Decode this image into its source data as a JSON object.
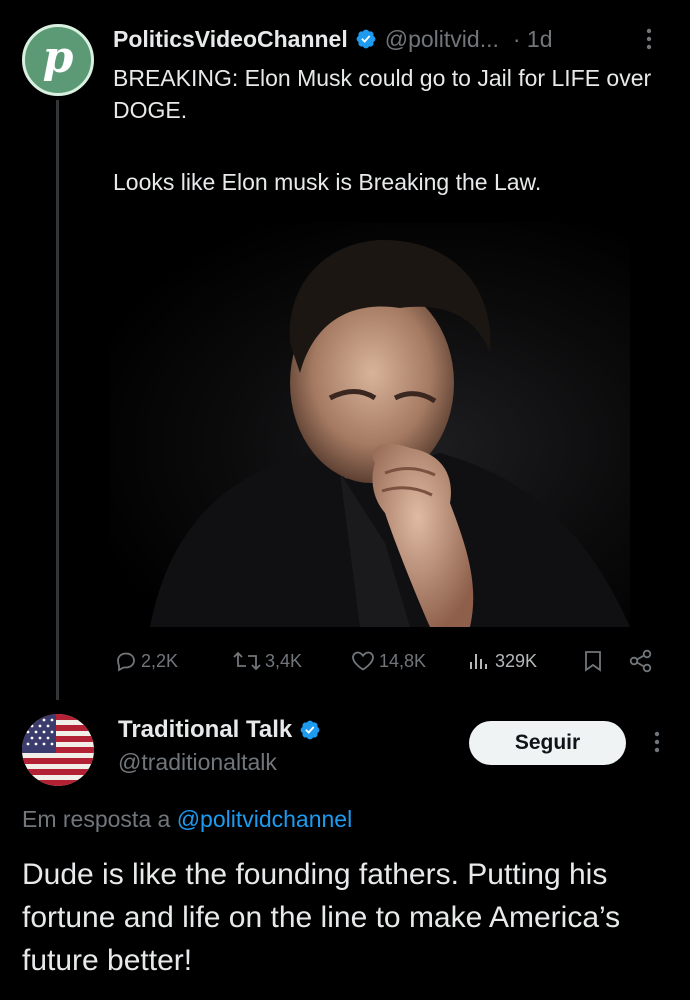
{
  "parent_tweet": {
    "avatar_letter": "p",
    "author_name": "PoliticsVideoChannel",
    "handle": "@politvid...",
    "time": "· 1d",
    "text_lines": [
      "BREAKING: Elon Musk could go to Jail for LIFE over DOGE.",
      "Looks like Elon musk is Breaking the Law."
    ],
    "stats": {
      "replies": "2,2K",
      "reposts": "3,4K",
      "likes": "14,8K",
      "views": "329K"
    }
  },
  "reply_tweet": {
    "author_name": "Traditional Talk",
    "handle": "@traditionaltalk",
    "follow_label": "Seguir",
    "reply_prefix": "Em resposta a",
    "reply_mention": "@politvidchannel",
    "text": "Dude is like the founding fathers. Putting his fortune and life on the line to make America’s future better!"
  },
  "colors": {
    "background": "#000000",
    "text": "#e7e9ea",
    "secondary": "#71767b",
    "accent": "#1d9bf0",
    "avatar_green": "#5b9a74"
  },
  "icons": [
    "verified-badge-icon",
    "more-icon",
    "reply-icon",
    "repost-icon",
    "like-icon",
    "views-icon",
    "bookmark-icon",
    "share-icon",
    "us-flag-avatar"
  ]
}
